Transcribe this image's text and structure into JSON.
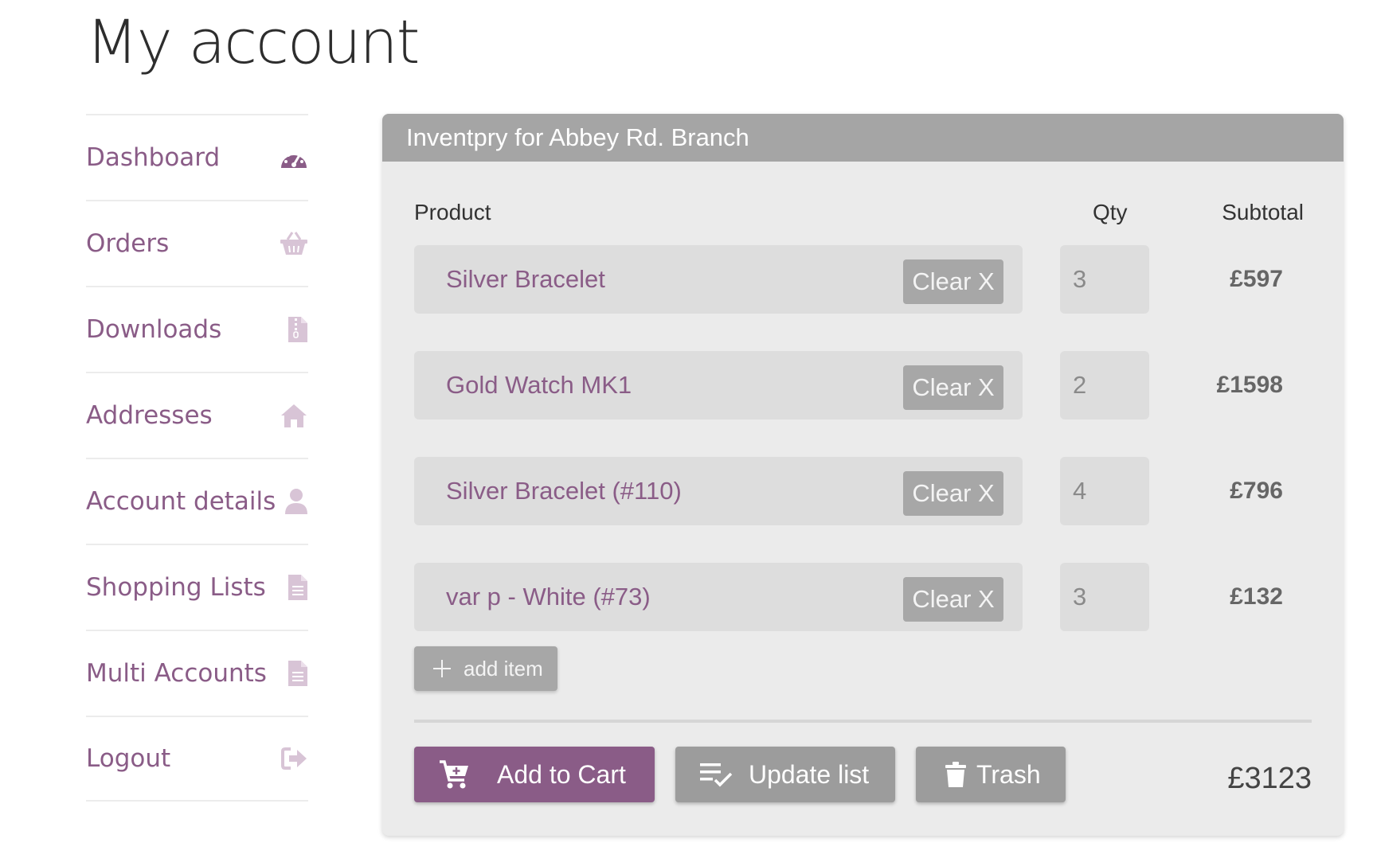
{
  "page": {
    "title": "My account"
  },
  "sidebar": {
    "items": [
      {
        "label": "Dashboard",
        "icon": "dashboard-gauge-icon"
      },
      {
        "label": "Orders",
        "icon": "basket-icon"
      },
      {
        "label": "Downloads",
        "icon": "zip-file-icon"
      },
      {
        "label": "Addresses",
        "icon": "home-icon"
      },
      {
        "label": "Account details",
        "icon": "user-icon"
      },
      {
        "label": "Shopping Lists",
        "icon": "document-icon"
      },
      {
        "label": "Multi Accounts",
        "icon": "document-icon"
      },
      {
        "label": "Logout",
        "icon": "sign-out-icon"
      }
    ]
  },
  "panel": {
    "title": "Inventpry for Abbey Rd. Branch",
    "columns": {
      "product": "Product",
      "qty": "Qty",
      "subtotal": "Subtotal"
    },
    "rows": [
      {
        "product": "Silver Bracelet",
        "clear": "Clear X",
        "qty": "3",
        "subtotal": "£597"
      },
      {
        "product": "Gold Watch MK1",
        "clear": "Clear X",
        "qty": "2",
        "subtotal": "£1598"
      },
      {
        "product": "Silver Bracelet (#110)",
        "clear": "Clear X",
        "qty": "4",
        "subtotal": "£796"
      },
      {
        "product": "var p - White (#73)",
        "clear": "Clear X",
        "qty": "3",
        "subtotal": "£132"
      }
    ],
    "add_item": "add item",
    "actions": {
      "add_to_cart": "Add to Cart",
      "update_list": "Update list",
      "trash": "Trash"
    },
    "total": "£3123"
  },
  "colors": {
    "accent": "#8a5c87",
    "header_bg": "#a5a5a5",
    "panel_bg": "#ebebeb",
    "button_grey": "#9c9c9c"
  }
}
